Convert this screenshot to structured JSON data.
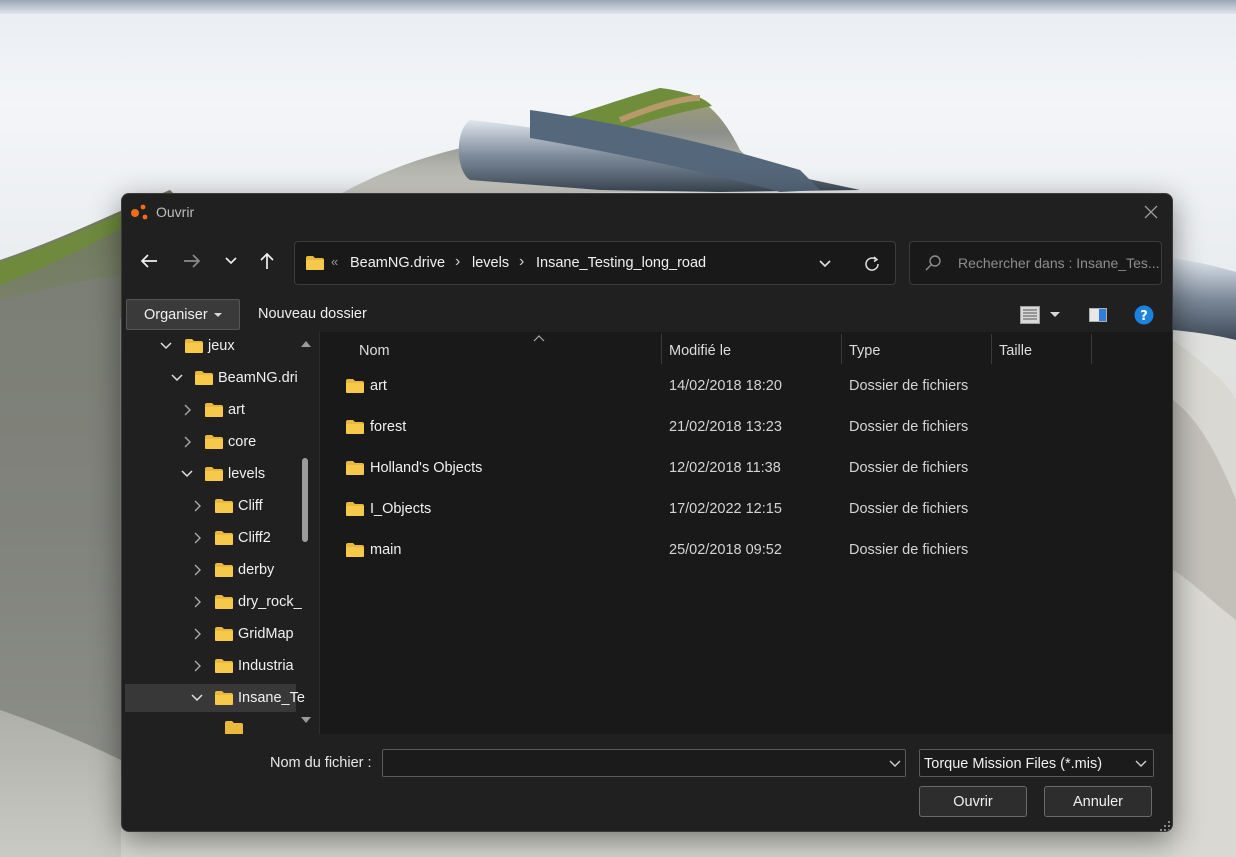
{
  "dialog": {
    "title": "Ouvrir",
    "icons": {
      "app": "app-dots-icon",
      "close": "close-icon"
    }
  },
  "navigation": {
    "back_icon": "arrow-left-icon",
    "forward_icon": "arrow-right-icon",
    "recent_icon": "chevron-down-icon",
    "up_icon": "arrow-up-icon",
    "breadcrumbs": [
      "BeamNG.drive",
      "levels",
      "Insane_Testing_long_road"
    ],
    "overflow_glyph": "«",
    "search_placeholder": "Rechercher dans : Insane_Tes..."
  },
  "toolbar": {
    "organize_label": "Organiser",
    "new_folder_label": "Nouveau dossier",
    "icons": [
      "view-list-icon",
      "preview-pane-icon",
      "help-icon"
    ]
  },
  "tree": {
    "items": [
      {
        "label": "jeux",
        "level": 1,
        "expanded": true
      },
      {
        "label": "BeamNG.dri",
        "level": 2,
        "expanded": true
      },
      {
        "label": "art",
        "level": 3,
        "expanded": false
      },
      {
        "label": "core",
        "level": 3,
        "expanded": false
      },
      {
        "label": "levels",
        "level": 3,
        "expanded": true
      },
      {
        "label": "Cliff",
        "level": 4,
        "expanded": false
      },
      {
        "label": "Cliff2",
        "level": 4,
        "expanded": false
      },
      {
        "label": "derby",
        "level": 4,
        "expanded": false
      },
      {
        "label": "dry_rock_",
        "level": 4,
        "expanded": false
      },
      {
        "label": "GridMap",
        "level": 4,
        "expanded": false
      },
      {
        "label": "Industria",
        "level": 4,
        "expanded": false
      },
      {
        "label": "Insane_Te",
        "level": 4,
        "expanded": true,
        "selected": true
      }
    ]
  },
  "list": {
    "columns": {
      "name": "Nom",
      "modified": "Modifié le",
      "type": "Type",
      "size": "Taille"
    },
    "rows": [
      {
        "name": "art",
        "modified": "14/02/2018 18:20",
        "type": "Dossier de fichiers"
      },
      {
        "name": "forest",
        "modified": "21/02/2018 13:23",
        "type": "Dossier de fichiers"
      },
      {
        "name": "Holland's Objects",
        "modified": "12/02/2018 11:38",
        "type": "Dossier de fichiers"
      },
      {
        "name": "I_Objects",
        "modified": "17/02/2022 12:15",
        "type": "Dossier de fichiers"
      },
      {
        "name": "main",
        "modified": "25/02/2018 09:52",
        "type": "Dossier de fichiers"
      }
    ]
  },
  "footer": {
    "filename_label": "Nom du fichier :",
    "filename_value": "",
    "filetype_value": "Torque Mission Files (*.mis)",
    "open_label": "Ouvrir",
    "cancel_label": "Annuler"
  },
  "colors": {
    "accent": "#0078d4",
    "folder": "#f4c542",
    "dialog_bg": "#202020",
    "list_bg": "#191919",
    "app_icon": "#f26b1d"
  }
}
